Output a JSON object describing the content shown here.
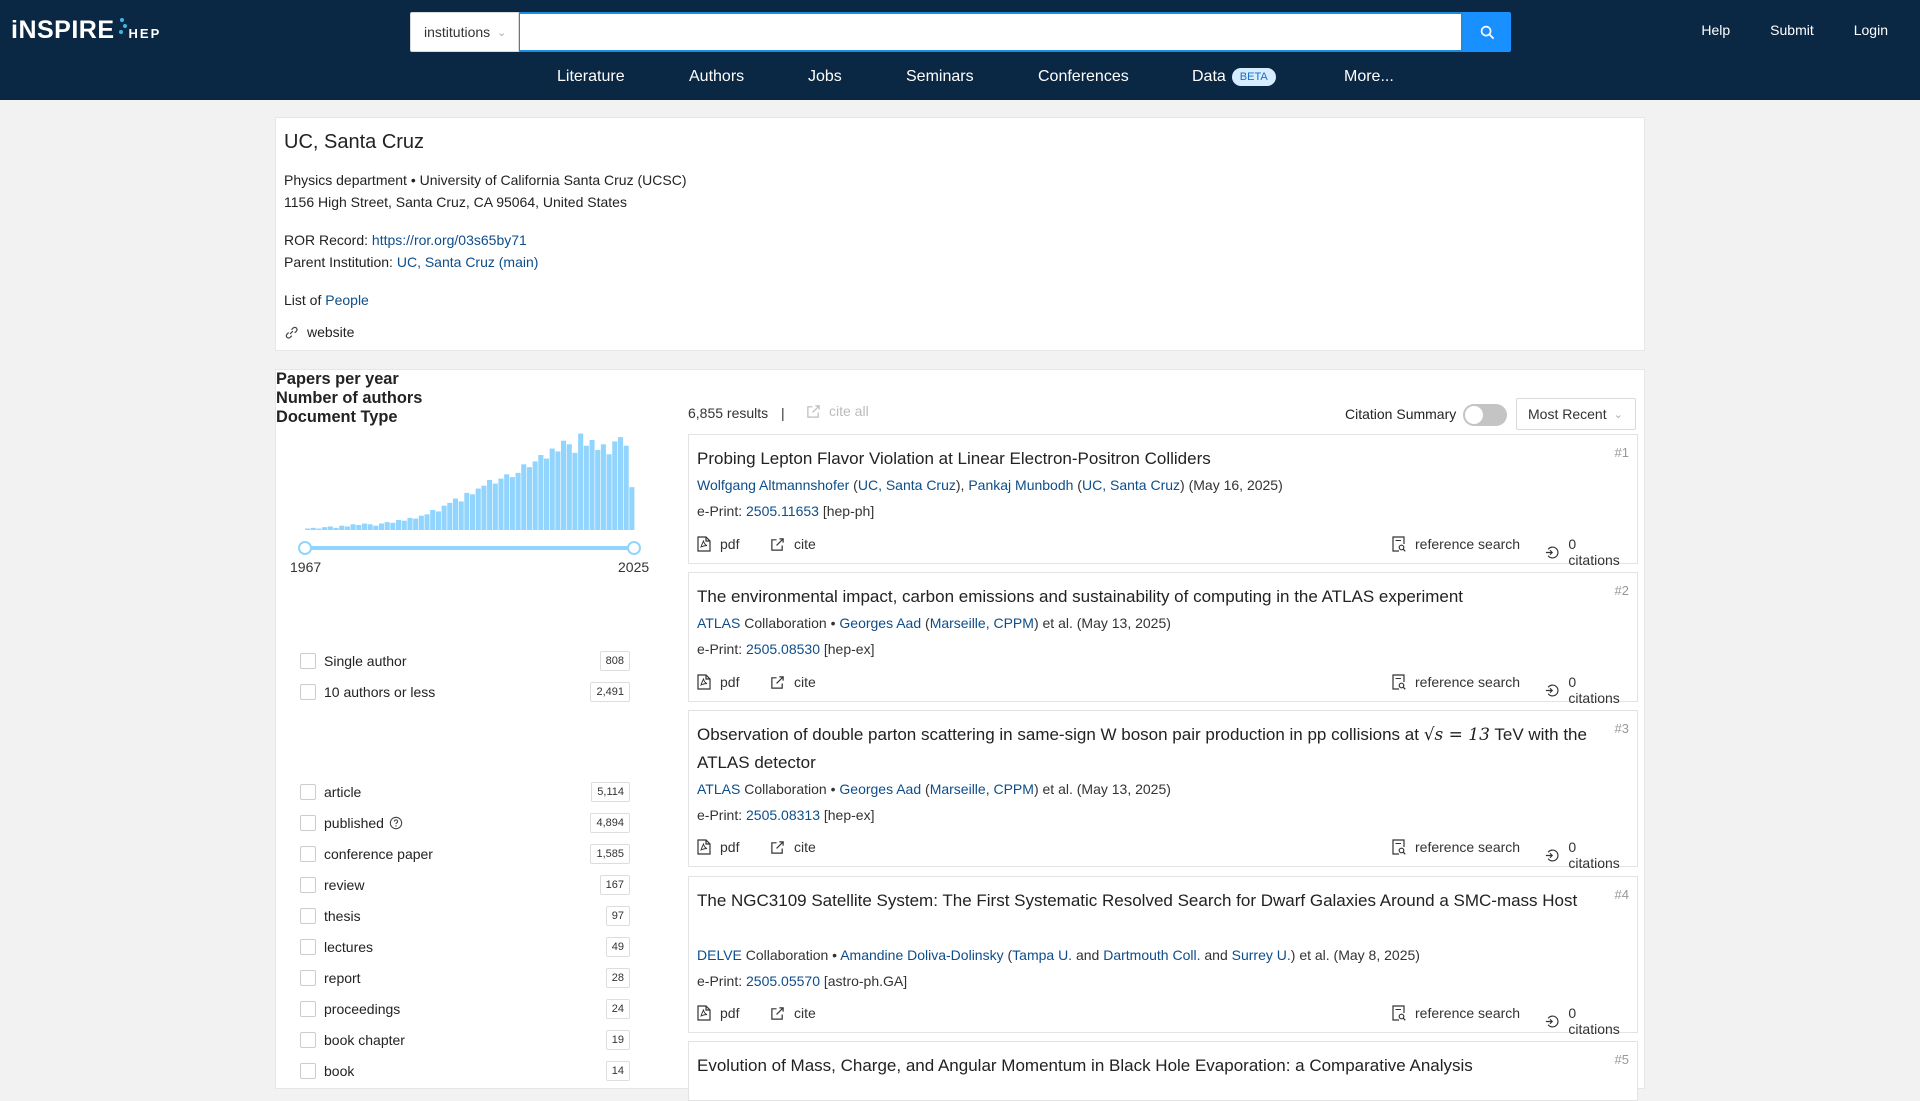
{
  "header": {
    "logo_main": "iNSPIRE",
    "logo_sub": "HEP",
    "search_scope": "institutions",
    "search_value": "",
    "links": [
      "Help",
      "Submit",
      "Login"
    ]
  },
  "nav": {
    "items": [
      "Literature",
      "Authors",
      "Jobs",
      "Seminars",
      "Conferences",
      "Data",
      "More..."
    ],
    "data_badge": "BETA"
  },
  "institution": {
    "name": "UC, Santa Cruz",
    "department_line": "Physics department • University of California Santa Cruz (UCSC)",
    "address": "1156 High Street, Santa Cruz, CA 95064, United States",
    "ror_label": "ROR Record:",
    "ror_link": "https://ror.org/03s65by71",
    "parent_label": "Parent Institution:",
    "parent_link": "UC, Santa Cruz (main)",
    "list_label": "List of",
    "people_link": "People",
    "website_label": "website"
  },
  "sidebar": {
    "papers_per_year_title": "Papers per year",
    "year_start": "1967",
    "year_end": "2025",
    "authors_title": "Number of authors",
    "authors_facets": [
      {
        "label": "Single author",
        "count": "808"
      },
      {
        "label": "10 authors or less",
        "count": "2,491"
      }
    ],
    "doctype_title": "Document Type",
    "doctype_facets": [
      {
        "label": "article",
        "count": "5,114"
      },
      {
        "label": "published",
        "count": "4,894"
      },
      {
        "label": "conference paper",
        "count": "1,585"
      },
      {
        "label": "review",
        "count": "167"
      },
      {
        "label": "thesis",
        "count": "97"
      },
      {
        "label": "lectures",
        "count": "49"
      },
      {
        "label": "report",
        "count": "28"
      },
      {
        "label": "proceedings",
        "count": "24"
      },
      {
        "label": "book chapter",
        "count": "19"
      },
      {
        "label": "book",
        "count": "14"
      }
    ]
  },
  "chart_data": {
    "type": "bar",
    "title": "Papers per year",
    "x_range": [
      1967,
      2025
    ],
    "bar_color": "#91d5ff",
    "values": [
      2,
      3,
      2,
      4,
      5,
      3,
      6,
      5,
      8,
      7,
      9,
      8,
      6,
      9,
      11,
      10,
      14,
      13,
      17,
      16,
      20,
      22,
      28,
      26,
      34,
      38,
      44,
      40,
      52,
      50,
      58,
      62,
      70,
      65,
      72,
      78,
      74,
      80,
      92,
      88,
      96,
      105,
      100,
      114,
      110,
      125,
      120,
      108,
      135,
      118,
      126,
      112,
      120,
      106,
      124,
      130,
      118,
      60
    ],
    "ylim": [
      0,
      140
    ]
  },
  "results": {
    "count": "6,855 results",
    "pipe": "|",
    "cite_all": "cite all",
    "citation_summary": "Citation Summary",
    "sort": "Most Recent",
    "items": [
      {
        "title": "Probing Lepton Flavor Violation at Linear Electron-Positron Colliders",
        "num": "#1",
        "date": "(May 16, 2025)",
        "eprint_label": "e-Print:",
        "eprint": "2505.11653",
        "category": "[hep-ph]",
        "pdf": "pdf",
        "cite": "cite",
        "ref_search": "reference search",
        "citations": "0 citations"
      },
      {
        "title": "The environmental impact, carbon emissions and sustainability of computing in the ATLAS experiment",
        "num": "#2",
        "date": "et al. (May 13, 2025)",
        "eprint_label": "e-Print:",
        "eprint": "2505.08530",
        "category": "[hep-ex]",
        "pdf": "pdf",
        "cite": "cite",
        "ref_search": "reference search",
        "citations": "0 citations"
      },
      {
        "title_a": "Observation of double parton scattering in same-sign W boson pair production in pp collisions at",
        "title_math": "√s = 13",
        "title_b": "TeV with the ATLAS detector",
        "num": "#3",
        "date": "et al. (May 13, 2025)",
        "eprint_label": "e-Print:",
        "eprint": "2505.08313",
        "category": "[hep-ex]",
        "pdf": "pdf",
        "cite": "cite",
        "ref_search": "reference search",
        "citations": "0 citations"
      },
      {
        "title": "The NGC3109 Satellite System: The First Systematic Resolved Search for Dwarf Galaxies Around a SMC-mass Host",
        "num": "#4",
        "date": "et al. (May 8, 2025)",
        "eprint_label": "e-Print:",
        "eprint": "2505.05570",
        "category": "[astro-ph.GA]",
        "pdf": "pdf",
        "cite": "cite",
        "ref_search": "reference search",
        "citations": "0 citations"
      },
      {
        "title": "Evolution of Mass, Charge, and Angular Momentum in Black Hole Evaporation: a Comparative Analysis",
        "num": "#5"
      }
    ],
    "r1_authors": {
      "a1": "Wolfgang Altmannshofer",
      "aff1": "UC, Santa Cruz",
      "a2": "Pankaj Munbodh",
      "aff2": "UC, Santa Cruz"
    },
    "collab_word": "Collaboration",
    "r2_authors": {
      "collab": "ATLAS",
      "a1": "Georges Aad",
      "aff1": "Marseille, CPPM"
    },
    "r3_authors": {
      "collab": "ATLAS",
      "a1": "Georges Aad",
      "aff1": "Marseille, CPPM"
    },
    "r4_authors": {
      "collab": "DELVE",
      "a1": "Amandine Doliva-Dolinsky",
      "aff1": "Tampa U.",
      "and": "and",
      "aff2": "Dartmouth Coll.",
      "aff3": "Surrey U."
    }
  }
}
